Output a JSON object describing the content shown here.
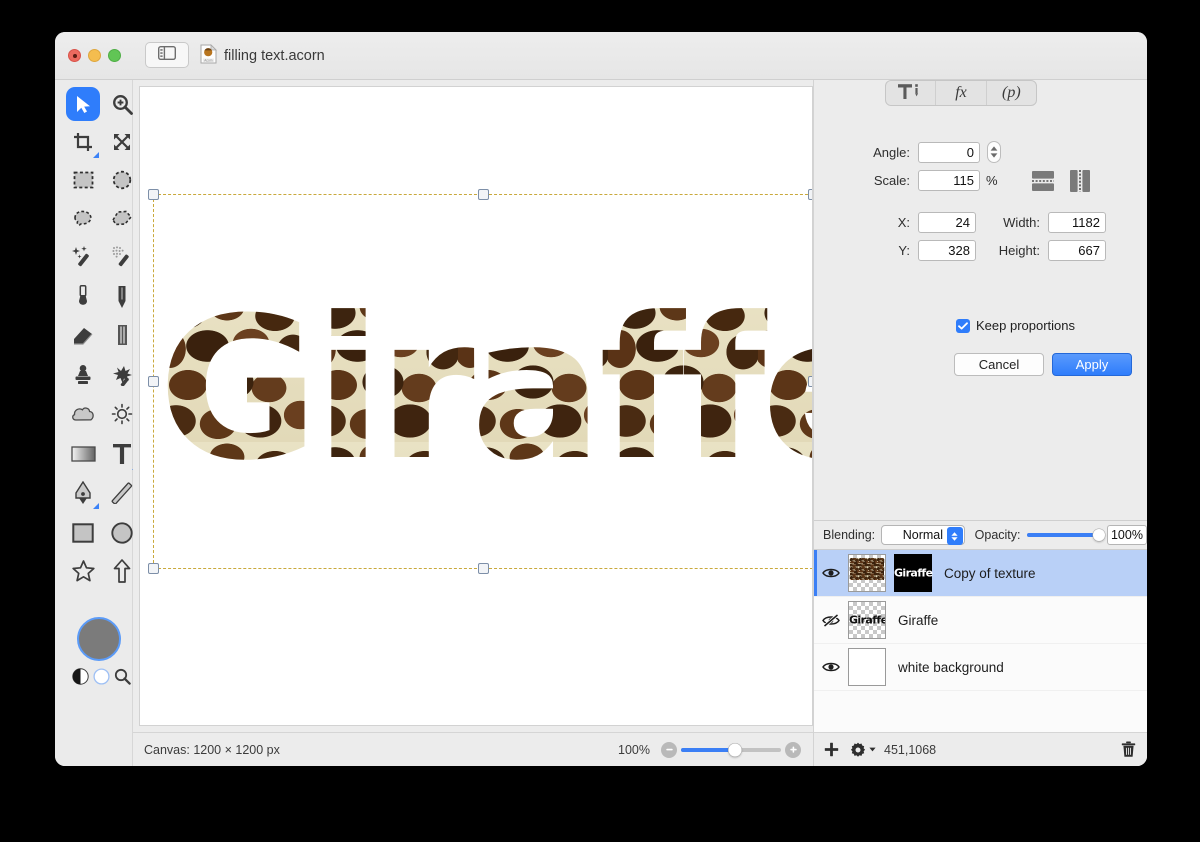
{
  "window": {
    "document_title": "filling text.acorn",
    "traffic_lights": [
      "close",
      "minimize",
      "zoom"
    ]
  },
  "toolbar": {
    "sidebar_toggle_icon": "sidebar-icon",
    "doc_icon": "acorn-document-icon"
  },
  "tools": [
    {
      "name": "move-tool",
      "icon": "cursor-arrow-icon",
      "selected": true
    },
    {
      "name": "zoom-tool",
      "icon": "magnifier-plus-icon",
      "selected": false
    },
    {
      "name": "crop-tool",
      "icon": "crop-icon",
      "selected": false
    },
    {
      "name": "transform-tool",
      "icon": "arrows-expand-icon",
      "selected": false
    },
    {
      "name": "rect-select-tool",
      "icon": "dashed-rectangle-icon",
      "selected": false
    },
    {
      "name": "ellipse-select-tool",
      "icon": "dashed-ellipse-icon",
      "selected": false
    },
    {
      "name": "lasso-tool",
      "icon": "lasso-icon",
      "selected": false
    },
    {
      "name": "polygon-lasso-tool",
      "icon": "polygon-lasso-icon",
      "selected": false
    },
    {
      "name": "magic-wand-tool",
      "icon": "magic-wand-icon",
      "selected": false
    },
    {
      "name": "instant-alpha-tool",
      "icon": "dotted-wand-icon",
      "selected": false
    },
    {
      "name": "brush-tool",
      "icon": "brush-icon",
      "selected": false
    },
    {
      "name": "pencil-tool",
      "icon": "pencil-icon",
      "selected": false
    },
    {
      "name": "eraser-tool",
      "icon": "eraser-icon",
      "selected": false
    },
    {
      "name": "blur-tool",
      "icon": "blur-bar-icon",
      "selected": false
    },
    {
      "name": "clone-stamp-tool",
      "icon": "stamp-icon",
      "selected": false
    },
    {
      "name": "smudge-tool",
      "icon": "smudge-icon",
      "selected": false
    },
    {
      "name": "dodge-tool",
      "icon": "cloud-icon",
      "selected": false
    },
    {
      "name": "burn-tool",
      "icon": "sun-icon",
      "selected": false
    },
    {
      "name": "gradient-tool",
      "icon": "gradient-icon",
      "selected": false
    },
    {
      "name": "text-tool",
      "icon": "text-t-icon",
      "selected": false
    },
    {
      "name": "bezier-tool",
      "icon": "pen-nib-icon",
      "selected": false
    },
    {
      "name": "line-tool",
      "icon": "line-icon",
      "selected": false
    },
    {
      "name": "rectangle-tool",
      "icon": "rectangle-icon",
      "selected": false
    },
    {
      "name": "ellipse-tool",
      "icon": "ellipse-icon",
      "selected": false
    },
    {
      "name": "star-tool",
      "icon": "star-icon",
      "selected": false
    },
    {
      "name": "arrow-tool",
      "icon": "arrow-up-icon",
      "selected": false
    }
  ],
  "color_well": {
    "name": "foreground-color-well",
    "color": "#7b7b7b",
    "mini_icons": [
      "contrast-icon",
      "circle-outline-icon",
      "magnifier-icon"
    ]
  },
  "canvas": {
    "text": "Giraffe",
    "selection_handles": 6
  },
  "status": {
    "canvas_size": "Canvas: 1200 × 1200 px",
    "zoom": "100%",
    "zoom_out_icon": "minus-circle-icon",
    "zoom_in_icon": "plus-circle-icon"
  },
  "inspector": {
    "segments": [
      {
        "name": "tools-tab",
        "icon": "hammer-icon",
        "label": ""
      },
      {
        "name": "filters-tab",
        "icon": "fx-icon",
        "label": "fx"
      },
      {
        "name": "palettes-tab",
        "icon": "p-icon",
        "label": "(p)"
      }
    ],
    "angle": {
      "label": "Angle:",
      "value": "0"
    },
    "scale": {
      "label": "Scale:",
      "value": "115",
      "unit": "%"
    },
    "x": {
      "label": "X:",
      "value": "24"
    },
    "y": {
      "label": "Y:",
      "value": "328"
    },
    "width": {
      "label": "Width:",
      "value": "1182"
    },
    "height": {
      "label": "Height:",
      "value": "667"
    },
    "keep_proportions": {
      "label": "Keep proportions",
      "checked": true
    },
    "flip_vertical_icon": "flip-vertical-icon",
    "flip_horizontal_icon": "flip-horizontal-icon",
    "cancel_label": "Cancel",
    "apply_label": "Apply",
    "accent_color": "#2f7dfb"
  },
  "layers_panel": {
    "blending_label": "Blending:",
    "blending_value": "Normal",
    "opacity_label": "Opacity:",
    "opacity_value": "100%",
    "layers": [
      {
        "name": "Copy of texture",
        "visible": true,
        "selected": true,
        "thumb": "texture-thumbnail",
        "mask_thumb": "Giraffe",
        "has_mask": true
      },
      {
        "name": "Giraffe",
        "visible": false,
        "selected": false,
        "thumb": "Giraffe",
        "has_mask": false
      },
      {
        "name": "white background",
        "visible": true,
        "selected": false,
        "thumb": "white-thumbnail",
        "has_mask": false
      }
    ],
    "footer": {
      "add_icon": "plus-icon",
      "settings_icon": "gear-icon",
      "coords": "451,1068",
      "delete_icon": "trash-icon"
    }
  }
}
